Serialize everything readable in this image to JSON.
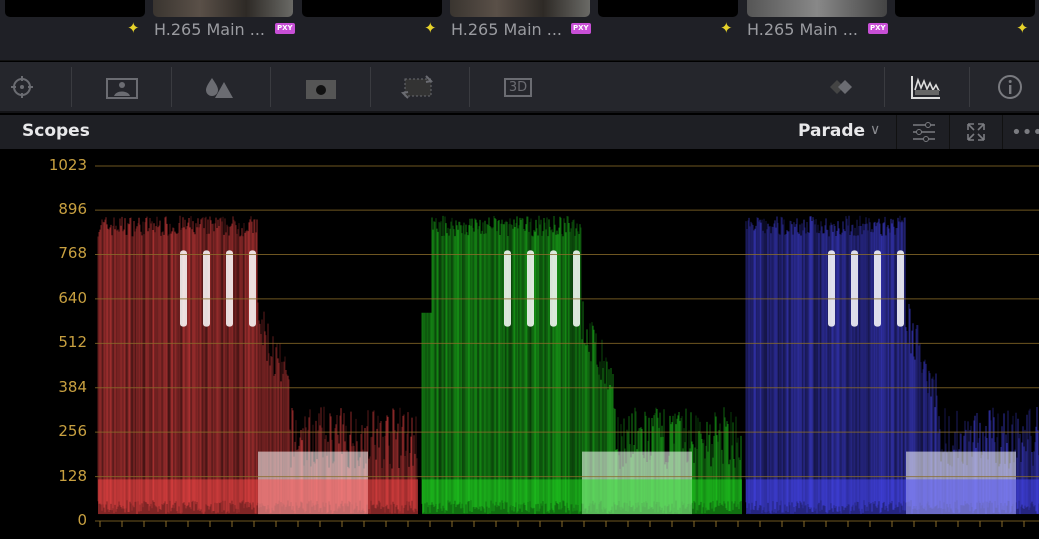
{
  "clips": [
    {
      "label": "H.265 Main ...",
      "badge": "PXY"
    },
    {
      "label": "H.265 Main ...",
      "badge": "PXY"
    },
    {
      "label": "H.265 Main ...",
      "badge": "PXY"
    }
  ],
  "toolbar": {
    "icons": [
      "target-icon",
      "picture-in-frame-icon",
      "color-drops-icon",
      "mask-icon",
      "transform-icon",
      "3d-icon",
      "layers-icon",
      "scopes-icon",
      "info-icon"
    ],
    "three_d": "3D"
  },
  "header": {
    "title": "Scopes",
    "mode": "Parade"
  },
  "scale": [
    "1023",
    "896",
    "768",
    "640",
    "512",
    "384",
    "256",
    "128",
    "0"
  ],
  "colors": {
    "red": "#ff4a4a",
    "green": "#22e022",
    "blue": "#4a4aff",
    "grid": "#8a6c2a",
    "label": "#c8a040"
  }
}
